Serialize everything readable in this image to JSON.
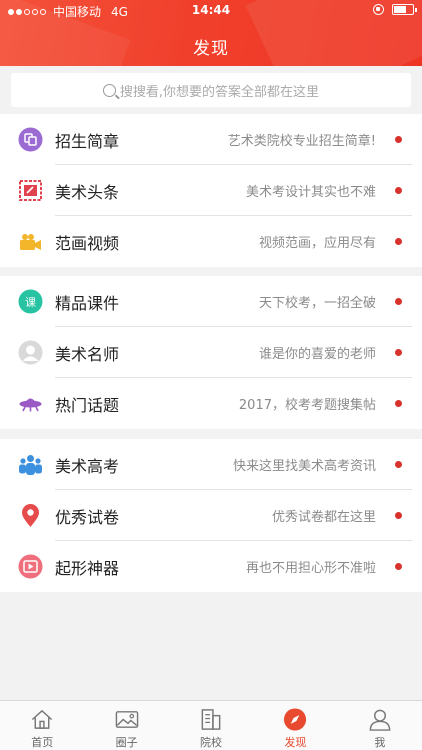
{
  "status": {
    "carrier": "中国移动",
    "network": "4G",
    "time": "14:44"
  },
  "header": {
    "title": "发现"
  },
  "search": {
    "placeholder": "搜搜看,你想要的答案全部都在这里"
  },
  "groups": [
    {
      "items": [
        {
          "label": "招生简章",
          "desc": "艺术类院校专业招生简章!",
          "icon": "brochure-icon",
          "color": "#9b6bd3"
        },
        {
          "label": "美术头条",
          "desc": "美术考设计其实也不难",
          "icon": "painting-frame-icon",
          "color": "#e0434e"
        },
        {
          "label": "范画视频",
          "desc": "视频范画，应用尽有",
          "icon": "video-camera-icon",
          "color": "#f3b52a"
        }
      ]
    },
    {
      "items": [
        {
          "label": "精品课件",
          "desc": "天下校考，一招全破",
          "icon": "course-icon",
          "color": "#27c3a2"
        },
        {
          "label": "美术名师",
          "desc": "谁是你的喜爱的老师",
          "icon": "teacher-avatar-icon",
          "color": "#c8c8c8"
        },
        {
          "label": "热门话题",
          "desc": "2017，校考考题搜集帖",
          "icon": "ufo-icon",
          "color": "#9b59c6"
        }
      ]
    },
    {
      "items": [
        {
          "label": "美术高考",
          "desc": "快来这里找美术高考资讯",
          "icon": "people-icon",
          "color": "#3d8fe0"
        },
        {
          "label": "优秀试卷",
          "desc": "优秀试卷都在这里",
          "icon": "location-pin-icon",
          "color": "#e74c4c"
        },
        {
          "label": "起形神器",
          "desc": "再也不用担心形不准啦",
          "icon": "play-tool-icon",
          "color": "#ef6f7c"
        }
      ]
    }
  ],
  "tabbar": {
    "items": [
      {
        "label": "首页",
        "icon": "home-icon"
      },
      {
        "label": "圈子",
        "icon": "image-icon"
      },
      {
        "label": "院校",
        "icon": "building-icon"
      },
      {
        "label": "发现",
        "icon": "compass-icon",
        "active": true
      },
      {
        "label": "我",
        "icon": "user-icon"
      }
    ]
  },
  "colors": {
    "header": "#f0402c",
    "accent": "#e84a2f",
    "badge": "#d8322c"
  }
}
